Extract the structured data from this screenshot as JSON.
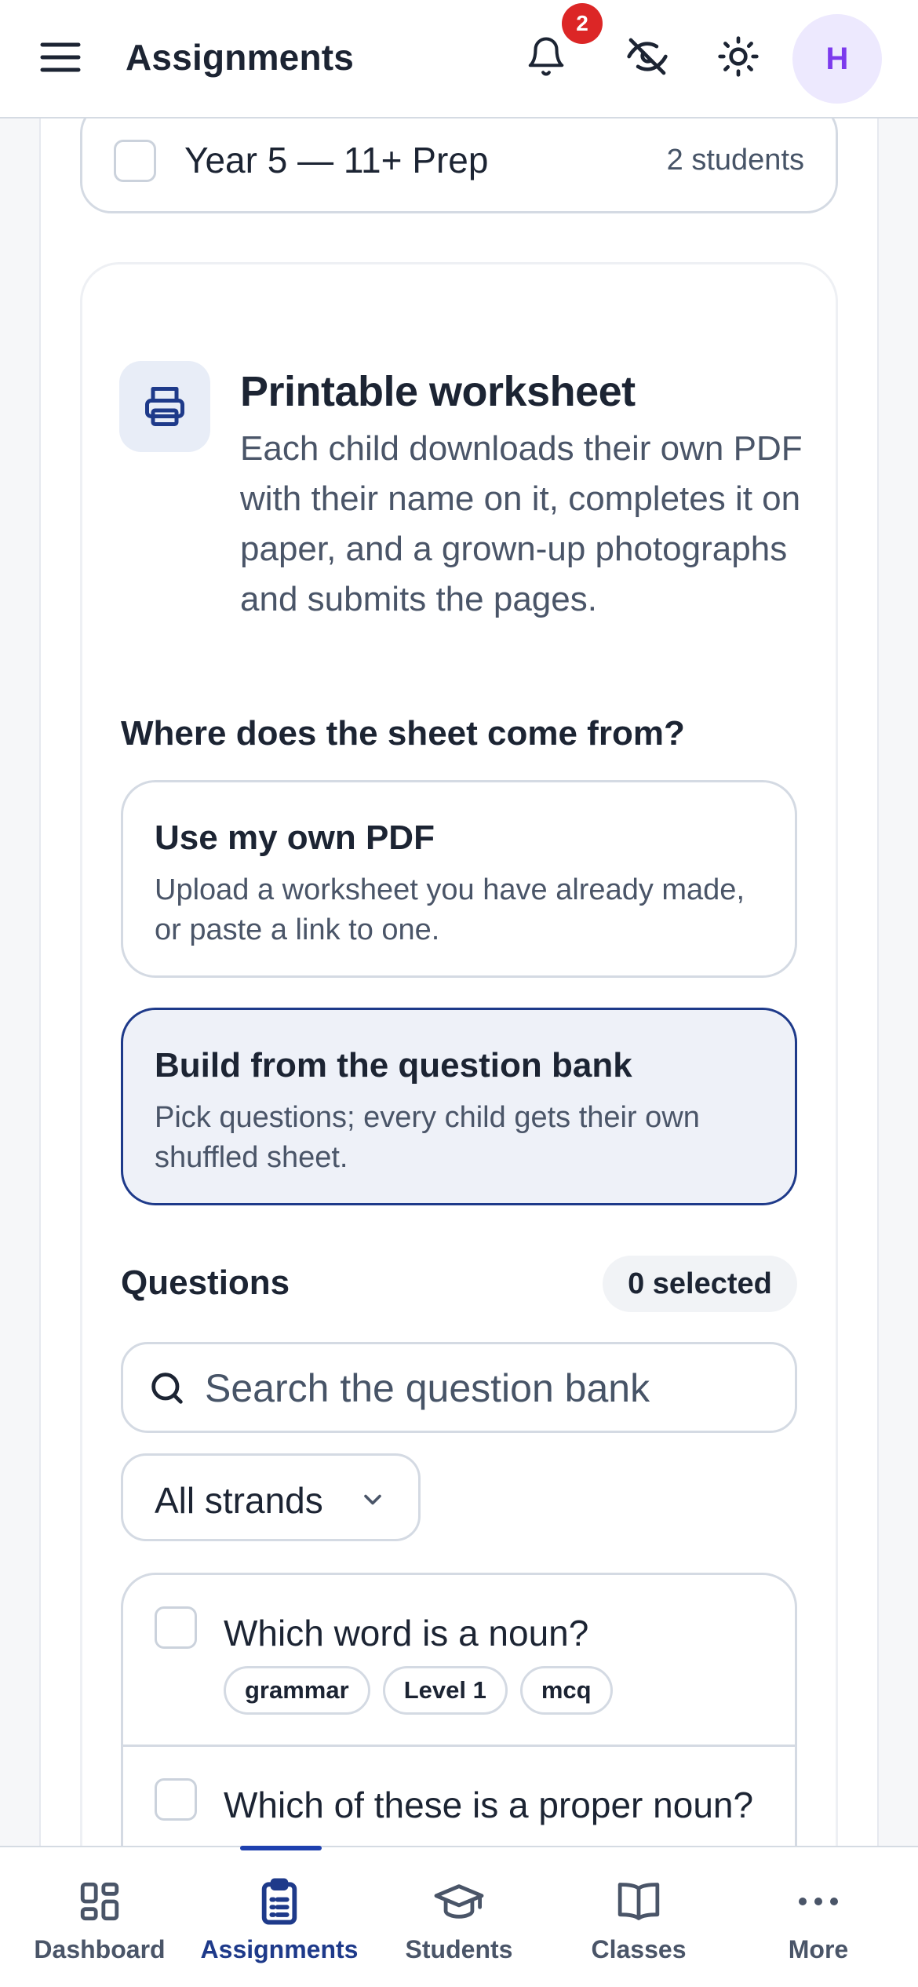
{
  "header": {
    "title": "Assignments",
    "notification_count": "2",
    "avatar_initial": "H"
  },
  "class_row": {
    "name": "Year 5 — 11+ Prep",
    "student_count": "2 students"
  },
  "worksheet": {
    "title": "Printable worksheet",
    "description": "Each child downloads their own PDF with their name on it, completes it on paper, and a grown-up photographs and submits the pages."
  },
  "source": {
    "question": "Where does the sheet come from?",
    "options": [
      {
        "title": "Use my own PDF",
        "description": "Upload a worksheet you have already made, or paste a link to one.",
        "selected": false
      },
      {
        "title": "Build from the question bank",
        "description": "Pick questions; every child gets their own shuffled sheet.",
        "selected": true
      }
    ]
  },
  "questions": {
    "label": "Questions",
    "selected_count": "0 selected",
    "search_placeholder": "Search the question bank",
    "strand_filter": "All strands",
    "items": [
      {
        "text": "Which word is a noun?",
        "tags": [
          "grammar",
          "Level 1",
          "mcq"
        ]
      },
      {
        "text": "Which of these is a proper noun?",
        "tags": []
      }
    ]
  },
  "bottom_nav": {
    "items": [
      {
        "label": "Dashboard",
        "icon": "dashboard-icon",
        "active": false
      },
      {
        "label": "Assignments",
        "icon": "clipboard-icon",
        "active": true
      },
      {
        "label": "Students",
        "icon": "graduation-cap-icon",
        "active": false
      },
      {
        "label": "Classes",
        "icon": "book-icon",
        "active": false
      },
      {
        "label": "More",
        "icon": "more-icon",
        "active": false
      }
    ]
  },
  "colors": {
    "accent": "#1e3a8a",
    "badge": "#dc2626",
    "avatar_bg": "#ede9fe",
    "avatar_text": "#7c3aed"
  }
}
